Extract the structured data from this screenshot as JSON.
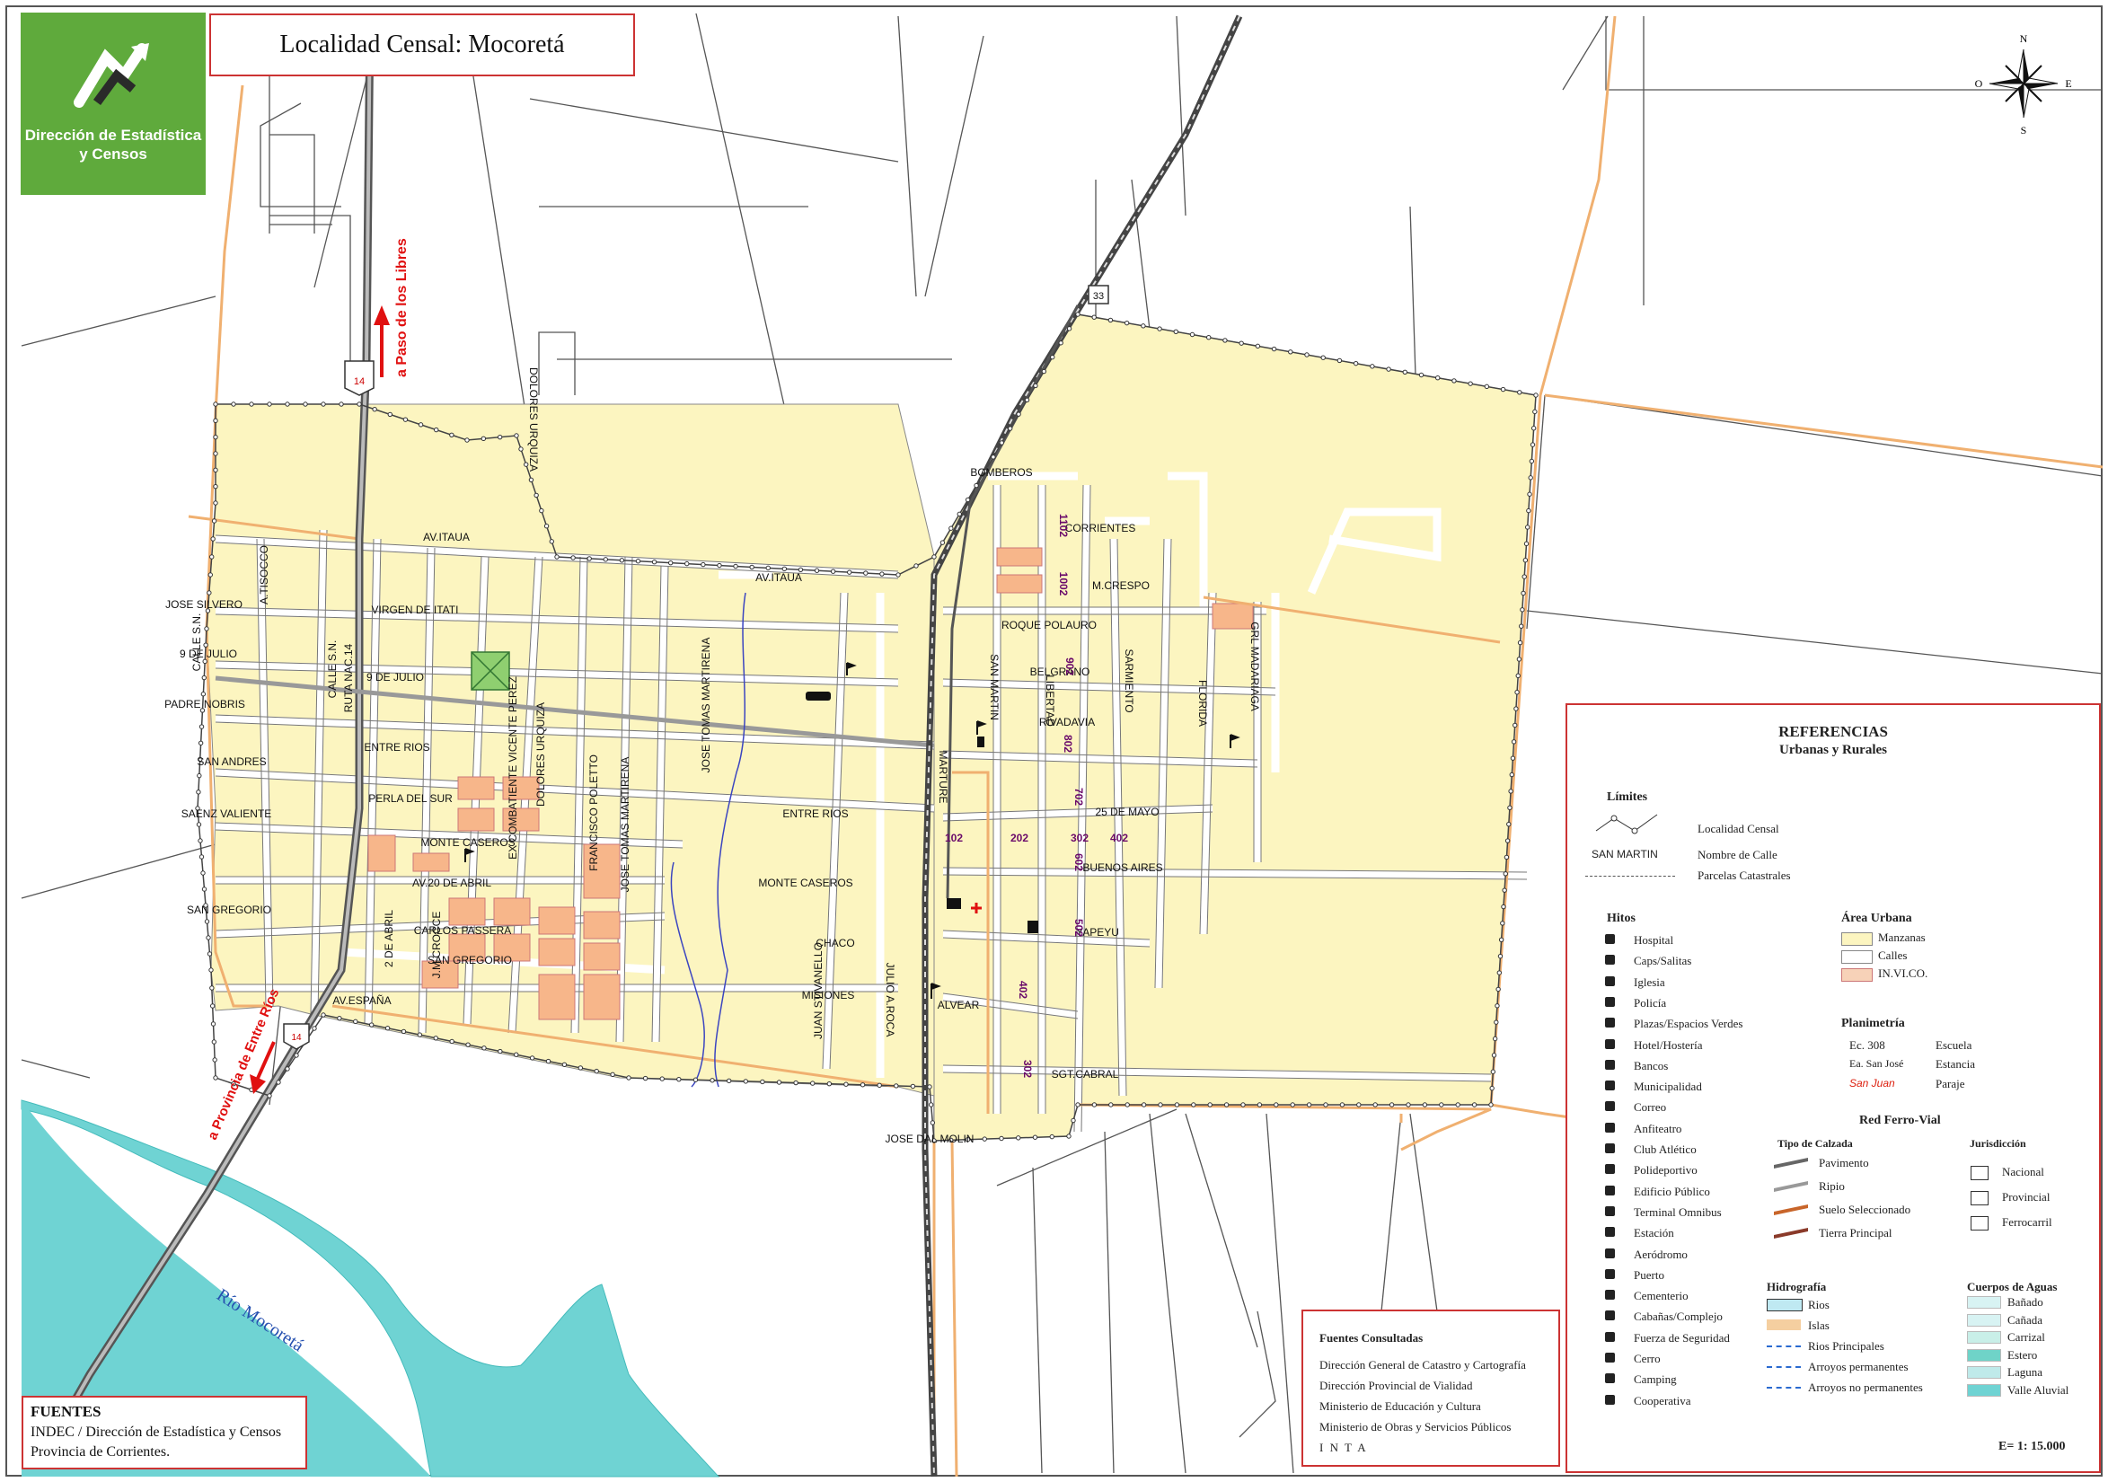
{
  "map_title": "Localidad Censal: Mocoretá",
  "logo_text": [
    "Dirección de Estadística",
    "y Censos"
  ],
  "compass": {
    "n": "N",
    "s": "S",
    "e": "E",
    "o": "O"
  },
  "route_labels": {
    "route14": "14",
    "route33": "33"
  },
  "direction_labels": {
    "north": "a  Paso de los Libres",
    "south": "a Provincia de Entre Ríos"
  },
  "river_label": "Río Mocoretá",
  "streets": [
    {
      "name": "AV.ITAUA"
    },
    {
      "name": "AV.ITAUA"
    },
    {
      "name": "BOMBEROS"
    },
    {
      "name": "CORRIENTES"
    },
    {
      "name": "M.CRESPO"
    },
    {
      "name": "ROQUE POLAURO"
    },
    {
      "name": "BELGRANO"
    },
    {
      "name": "RIVADAVIA"
    },
    {
      "name": "25 DE MAYO"
    },
    {
      "name": "BUENOS AIRES"
    },
    {
      "name": "YAPEYU"
    },
    {
      "name": "ALVEAR"
    },
    {
      "name": "SGT.CABRAL"
    },
    {
      "name": "JOSE DAL MOLIN"
    },
    {
      "name": "ENTRE RIOS"
    },
    {
      "name": "MONTE CASEROS"
    },
    {
      "name": "CHACO"
    },
    {
      "name": "MISIONES"
    },
    {
      "name": "VIRGEN DE ITATI"
    },
    {
      "name": "9 DE JULIO"
    },
    {
      "name": "9 DE JULIO"
    },
    {
      "name": "JOSE SILVERO"
    },
    {
      "name": "PADRE NOBRIS"
    },
    {
      "name": "SAN ANDRES"
    },
    {
      "name": "SAENZ VALIENTE"
    },
    {
      "name": "SAN GREGORIO"
    },
    {
      "name": "ENTRE RIOS"
    },
    {
      "name": "PERLA DEL SUR"
    },
    {
      "name": "MONTE CASEROS"
    },
    {
      "name": "AV.20 DE ABRIL"
    },
    {
      "name": "CARLOS PASSERA"
    },
    {
      "name": "SAN GREGORIO"
    },
    {
      "name": "AV.ESPAÑA"
    },
    {
      "name": "CALLE S.N."
    },
    {
      "name": "CALLE S.N."
    },
    {
      "name": "A.TISOCCO"
    },
    {
      "name": "RUTA NAC.14"
    },
    {
      "name": "EX COMBATIENTE VICENTE PEREZ"
    },
    {
      "name": "DOLORES URQUIZA"
    },
    {
      "name": "DOLORES URQUIZA"
    },
    {
      "name": "FRANCISCO POLETTO"
    },
    {
      "name": "JOSE TOMAS MARTIRENA"
    },
    {
      "name": "JOSE TOMAS MARTIRENA"
    },
    {
      "name": "JUAN STIVANELLO"
    },
    {
      "name": "JULIO A.ROCA"
    },
    {
      "name": "2 DE ABRIL"
    },
    {
      "name": "J.M.CROCCE"
    },
    {
      "name": "SAN MARTIN"
    },
    {
      "name": "LIBERTAD"
    },
    {
      "name": "SARMIENTO"
    },
    {
      "name": "FLORIDA"
    },
    {
      "name": "GRL MADARIAGA"
    },
    {
      "name": "MARTURE"
    }
  ],
  "radio_numbers": [
    "1102",
    "1002",
    "902",
    "802",
    "702",
    "602",
    "502",
    "402",
    "302",
    "202",
    "102",
    "302",
    "402"
  ],
  "legend": {
    "title": "REFERENCIAS",
    "subtitle": "Urbanas   y   Rurales",
    "limits_heading": "Límites",
    "limits": [
      "Localidad Censal",
      "Nombre de Calle",
      "Parcelas Catastrales"
    ],
    "sample_street": "SAN MARTIN",
    "hitos_heading": "Hitos",
    "hitos": [
      "Hospital",
      "Caps/Salitas",
      "Iglesia",
      "Policía",
      "Plazas/Espacios Verdes",
      "Hotel/Hostería",
      "Bancos",
      "Municipalidad",
      "Correo",
      "Anfiteatro",
      "Club  Atlético",
      "Polideportivo",
      "Edificio Público",
      "Terminal Omnibus",
      "Estación",
      "Aeródromo",
      "Puerto",
      "Cementerio",
      "Cabañas/Complejo",
      "Fuerza de Seguridad",
      "Cerro",
      "Camping",
      "Cooperativa"
    ],
    "area_urbana_heading": "Área Urbana",
    "area_urbana": [
      "Manzanas",
      "Calles",
      "IN.VI.CO."
    ],
    "planimetria_heading": "Planimetría",
    "planimetria": [
      {
        "sample": "Ec. 308",
        "label": "Escuela"
      },
      {
        "sample": "Ea. San José",
        "label": "Estancia"
      },
      {
        "sample": "San Juan",
        "label": "Paraje"
      }
    ],
    "red_heading": "Red Ferro-Vial",
    "calzada_heading": "Tipo de Calzada",
    "calzada": [
      "Pavimento",
      "Ripio",
      "Suelo Seleccionado",
      "Tierra Principal"
    ],
    "jurisdiccion_heading": "Jurisdicción",
    "jurisdiccion": [
      "Nacional",
      "Provincial",
      "Ferrocarril"
    ],
    "hidro_heading": "Hidrografía",
    "hidro": [
      "Rios",
      "Islas",
      "Rios Principales",
      "Arroyos permanentes",
      "Arroyos  no  permanentes"
    ],
    "cuerpos_heading": "Cuerpos de Aguas",
    "cuerpos": [
      "Bañado",
      "Cañada",
      "Carrizal",
      "Estero",
      "Laguna",
      "Valle Aluvial"
    ],
    "scale": "E= 1: 15.000"
  },
  "sources": {
    "heading": "Fuentes Consultadas",
    "items": [
      "Dirección General de Catastro y Cartografía",
      "Dirección Provincial de Vialidad",
      "Ministerio de Educación y Cultura",
      "Ministerio de Obras y Servicios Públicos",
      "I N T A"
    ]
  },
  "fuentes": {
    "heading": "FUENTES",
    "lines": [
      "INDEC / Dirección de Estadística y Censos",
      "Provincia de Corrientes."
    ]
  },
  "colors": {
    "manzana": "#fcf5c0",
    "river": "#6fd3d3",
    "road_orange": "#f0b070",
    "invico": "#f7b68a",
    "logo_green": "#5faa3c",
    "frame_red": "#cc3333",
    "radio_purple": "#6a0a6a",
    "arrow_red": "#e01010"
  }
}
